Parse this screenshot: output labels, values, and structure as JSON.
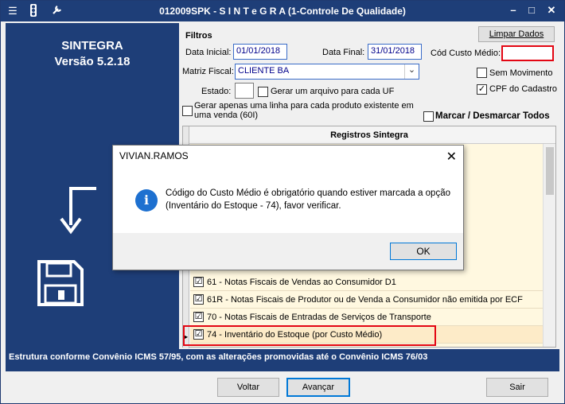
{
  "window": {
    "title": "012009SPK - S I N T e G R A (1-Controle De Qualidade)",
    "minimize": "–",
    "maximize": "□",
    "close": "✕"
  },
  "sidebar": {
    "app_name": "SINTEGRA",
    "version": "Versão 5.2.18"
  },
  "filters": {
    "heading": "Filtros",
    "clear_button": "Limpar Dados",
    "start_date_label": "Data Inicial:",
    "start_date": "01/01/2018",
    "end_date_label": "Data Final:",
    "end_date": "31/01/2018",
    "cost_code_label": "Cód Custo Médio:",
    "cost_code": "",
    "matrix_label": "Matriz Fiscal:",
    "matrix": "CLIENTE BA",
    "state_label": "Estado:",
    "state": "",
    "one_file_per_uf": "Gerar um arquivo para cada UF",
    "no_movement": "Sem Movimento",
    "cpf_registry": "CPF do Cadastro",
    "one_line_per_product": "Gerar apenas uma linha para cada produto existente em uma venda (60I)",
    "toggle_all": "Marcar / Desmarcar Todos"
  },
  "grid": {
    "header": "Registros Sintegra",
    "rows": [
      {
        "label": "61 - Notas Fiscais de Vendas ao Consumidor D1",
        "checked": "☑"
      },
      {
        "label": "61R - Notas Fiscais de Produtor ou de Venda a Consumidor não emitida por ECF",
        "checked": "☑"
      },
      {
        "label": "70 - Notas Fiscais de Entradas de Serviços de Transporte",
        "checked": "☑"
      },
      {
        "label": "74 - Inventário do Estoque (por Custo Médio)",
        "checked": "☑"
      }
    ],
    "current_row_marker": "▶"
  },
  "status_bar": "Estrutura conforme Convênio ICMS 57/95, com as alterações promovidas até o Convênio ICMS 76/03",
  "footer": {
    "back": "Voltar",
    "next": "Avançar",
    "exit": "Sair"
  },
  "dialog": {
    "title": "VIVIAN.RAMOS",
    "close": "✕",
    "icon": "i",
    "message": "Código do Custo Médio é obrigatório quando estiver marcada a opção (Inventário do Estoque - 74), favor verificar.",
    "ok": "OK"
  },
  "icons": {
    "app_menu": "☰",
    "traffic_light": "🚦",
    "tools": "🔧",
    "dropdown": "⌄"
  },
  "colors": {
    "title_bar": "#1e3e78",
    "highlight": "#e30613",
    "dialog_accent": "#1d70d0"
  }
}
